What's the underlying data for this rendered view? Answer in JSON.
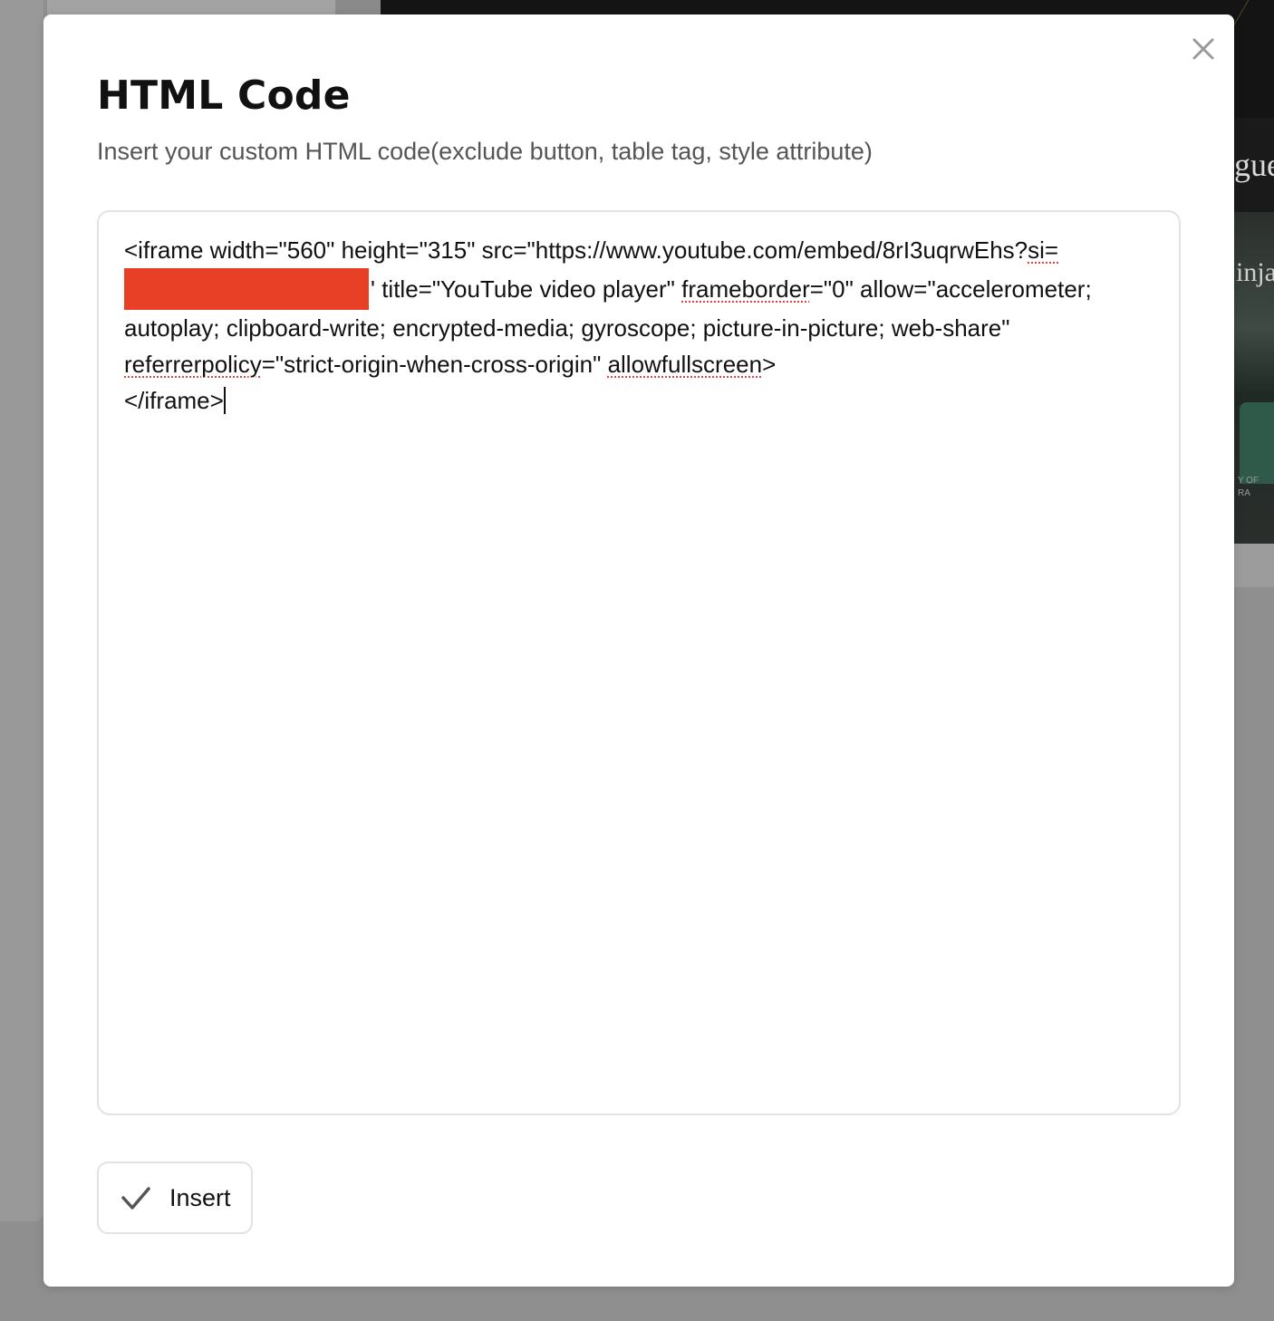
{
  "background": {
    "heading_fragment": "gue",
    "photo_label_fragment": "inja",
    "photo_caption_fragment": "Y OF\nRA"
  },
  "modal": {
    "title": "HTML Code",
    "subtitle": "Insert your custom HTML code(exclude button, table tag, style attribute)",
    "close_icon": "close-icon",
    "code": {
      "part1": "<iframe width=\"560\" height=\"315\" src=\"https://www.youtube.com/embed/8rI3uqrwEhs?",
      "part2_start": "si=",
      "part3": "' title=\"YouTube video player\" ",
      "word_frameborder": "frameborder",
      "part4": "=\"0\" allow=\"accelerometer; autoplay; clipboard-write; encrypted-media; gyroscope; picture-in-picture; web-share\" ",
      "word_referrerpolicy": "referrerpolicy",
      "part5": "=\"strict-origin-when-cross-origin\" ",
      "word_allowfullscreen": "allowfullscreen",
      "part6": ">\n</iframe>"
    },
    "redaction_color": "#e84027",
    "insert_button": {
      "label": "Insert",
      "icon": "check-icon"
    }
  }
}
